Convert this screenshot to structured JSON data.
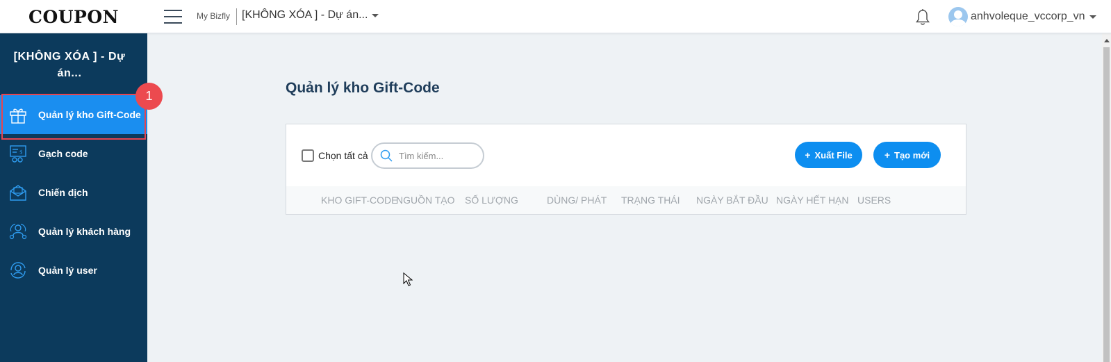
{
  "header": {
    "logo": "COUPON",
    "my_bizfly": "My Bizfly",
    "project_name": "[KHÔNG XÓA ] - Dự án...",
    "username": "anhvoleque_vccorp_vn"
  },
  "sidebar": {
    "project_title": "[KHÔNG XÓA ] - Dự án...",
    "badge": "1",
    "items": [
      {
        "label": "Quản lý kho Gift-Code",
        "icon": "gift-icon",
        "active": true
      },
      {
        "label": "Gạch code",
        "icon": "code-scratch-icon",
        "active": false
      },
      {
        "label": "Chiến dịch",
        "icon": "campaign-icon",
        "active": false
      },
      {
        "label": "Quản lý khách hàng",
        "icon": "customers-icon",
        "active": false
      },
      {
        "label": "Quản lý user",
        "icon": "user-manage-icon",
        "active": false
      }
    ]
  },
  "main": {
    "page_title": "Quản lý kho Gift-Code",
    "select_all_label": "Chọn tất cả",
    "search_placeholder": "Tìm kiếm...",
    "export_label": "Xuất File",
    "create_label": "Tạo mới",
    "columns": [
      "KHO GIFT-CODE",
      "NGUỒN TẠO",
      "SỐ LƯỢNG",
      "DÙNG/ PHÁT",
      "TRẠNG THÁI",
      "NGÀY BẮT ĐẦU",
      "NGÀY HẾT HẠN",
      "USERS"
    ]
  },
  "colors": {
    "sidebar_bg": "#0c3a5c",
    "active_item": "#1a8ef0",
    "primary_button": "#0d8ef0",
    "highlight_outline": "#e64550"
  }
}
